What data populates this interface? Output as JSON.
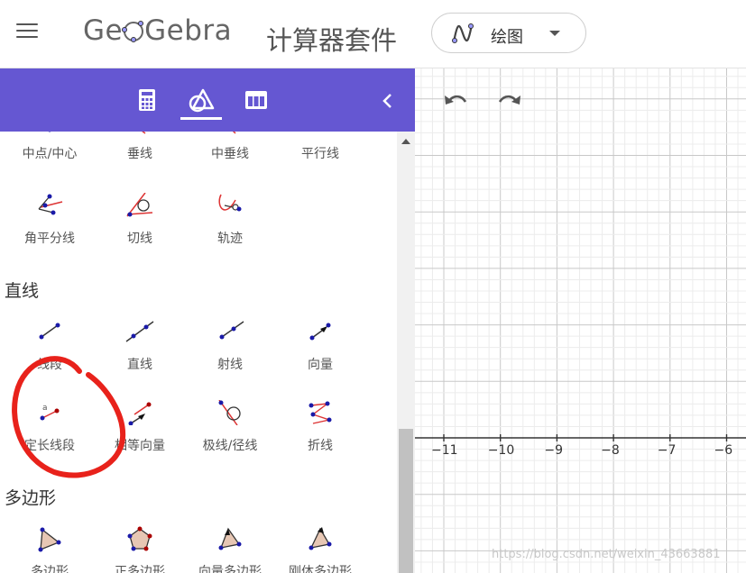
{
  "header": {
    "logo_text_left": "Ge",
    "logo_text_right": "Gebra",
    "title": "计算器套件",
    "app_picker_label": "绘图"
  },
  "toolbar": {
    "tabs": [
      "calculator-tab",
      "tools-tab",
      "table-tab"
    ],
    "active_tab": "tools-tab"
  },
  "tools": {
    "row_top": [
      "中点/中心",
      "垂线",
      "中垂线",
      "平行线"
    ],
    "row_construct": [
      "角平分线",
      "切线",
      "轨迹"
    ],
    "section_lines": "直线",
    "row_lines1": [
      "线段",
      "直线",
      "射线",
      "向量"
    ],
    "row_lines2": [
      "定长线段",
      "相等向量",
      "极线/径线",
      "折线"
    ],
    "section_polygons": "多边形",
    "row_polygons": [
      "多边形",
      "正多边形",
      "向量多边形",
      "刚体多边形"
    ]
  },
  "graphics": {
    "x_ticks": [
      "−11",
      "−10",
      "−9",
      "−8",
      "−7",
      "−6"
    ]
  },
  "watermark": "https://blog.csdn.net/weixin_43663881",
  "colors": {
    "toolbar": "#6557d2",
    "annotation": "#e8221b",
    "grid_major": "#c8c8c8",
    "grid_minor": "#ececec"
  }
}
